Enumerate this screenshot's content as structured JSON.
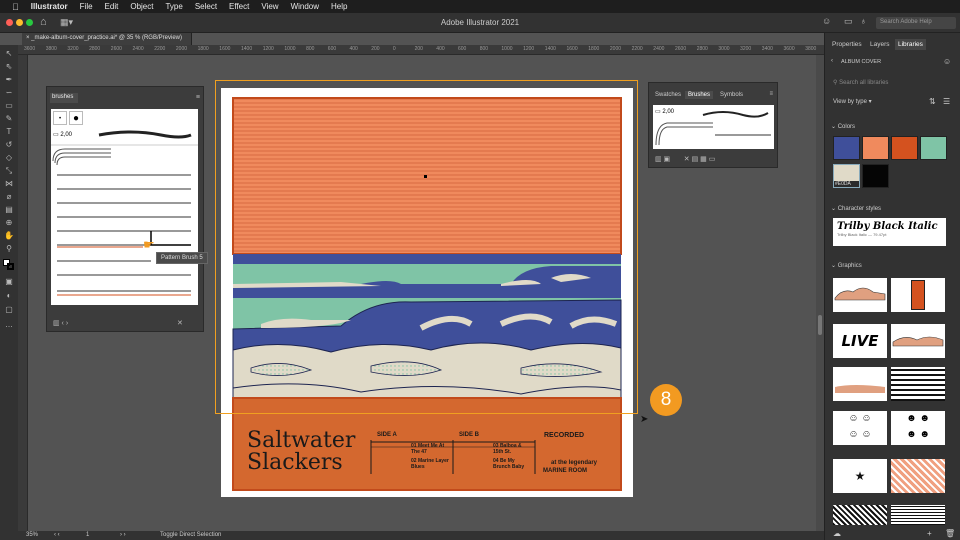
{
  "menubar": {
    "apple": "",
    "app": "Illustrator",
    "items": [
      "File",
      "Edit",
      "Object",
      "Type",
      "Select",
      "Effect",
      "View",
      "Window",
      "Help"
    ]
  },
  "window": {
    "title": "Adobe Illustrator 2021",
    "search_placeholder": "Search Adobe Help"
  },
  "document": {
    "tab": "_make-album-cover_practice.ai* @ 35 % (RGB/Preview)"
  },
  "ruler": {
    "ticks": [
      "3600",
      "3800",
      "3200",
      "2800",
      "2600",
      "2400",
      "2200",
      "2000",
      "1800",
      "1600",
      "1400",
      "1200",
      "1000",
      "800",
      "600",
      "400",
      "200",
      "0",
      "200",
      "400",
      "600",
      "800",
      "1000",
      "1200",
      "1400",
      "1600",
      "1800",
      "2000",
      "2200",
      "2400",
      "2600",
      "2800",
      "3000",
      "3200",
      "3400",
      "3600",
      "3800"
    ]
  },
  "status": {
    "zoom": "35%",
    "artboard": "1",
    "tool_hint": "Toggle Direct Selection"
  },
  "brushes_panel": {
    "tab": "brushes",
    "size_label": "2,00",
    "tooltip": "Pattern Brush 5"
  },
  "mini_panel": {
    "tabs": [
      "Swatches",
      "Brushes",
      "Symbols"
    ],
    "active": "Brushes",
    "size_label": "2,00"
  },
  "badge": {
    "number": "8"
  },
  "album": {
    "title_line1": "Saltwater",
    "title_line2": "Slackers",
    "side_a": "SIDE A",
    "side_b": "SIDE B",
    "recorded": "RECORDED",
    "track1": "01 Meet Me At The 47",
    "track2": "02 Marine Layer Blues",
    "track3": "03 Balboa & 15th St.",
    "track4": "04 Be My Brunch Baby",
    "venue1": "at the legendary",
    "venue2": "MARINE ROOM"
  },
  "right_panel": {
    "tabs": [
      "Properties",
      "Layers",
      "Libraries"
    ],
    "active": "Libraries",
    "library": "ALBUM COVER",
    "search_placeholder": "Search all libraries",
    "view": "View by type",
    "colors_label": "Colors",
    "colors": [
      "#3f4f9a",
      "#f08a5d",
      "#d4521f",
      "#7fc4a6",
      "#e0dac8",
      "#050505"
    ],
    "selected_color": "#E0DA",
    "char_styles_label": "Character styles",
    "char_style_name": "Trilby Black Italic",
    "char_style_meta": "Trilby Black Italic — 79.47pt",
    "graphics_label": "Graphics",
    "graphic_live": "LIVE"
  }
}
